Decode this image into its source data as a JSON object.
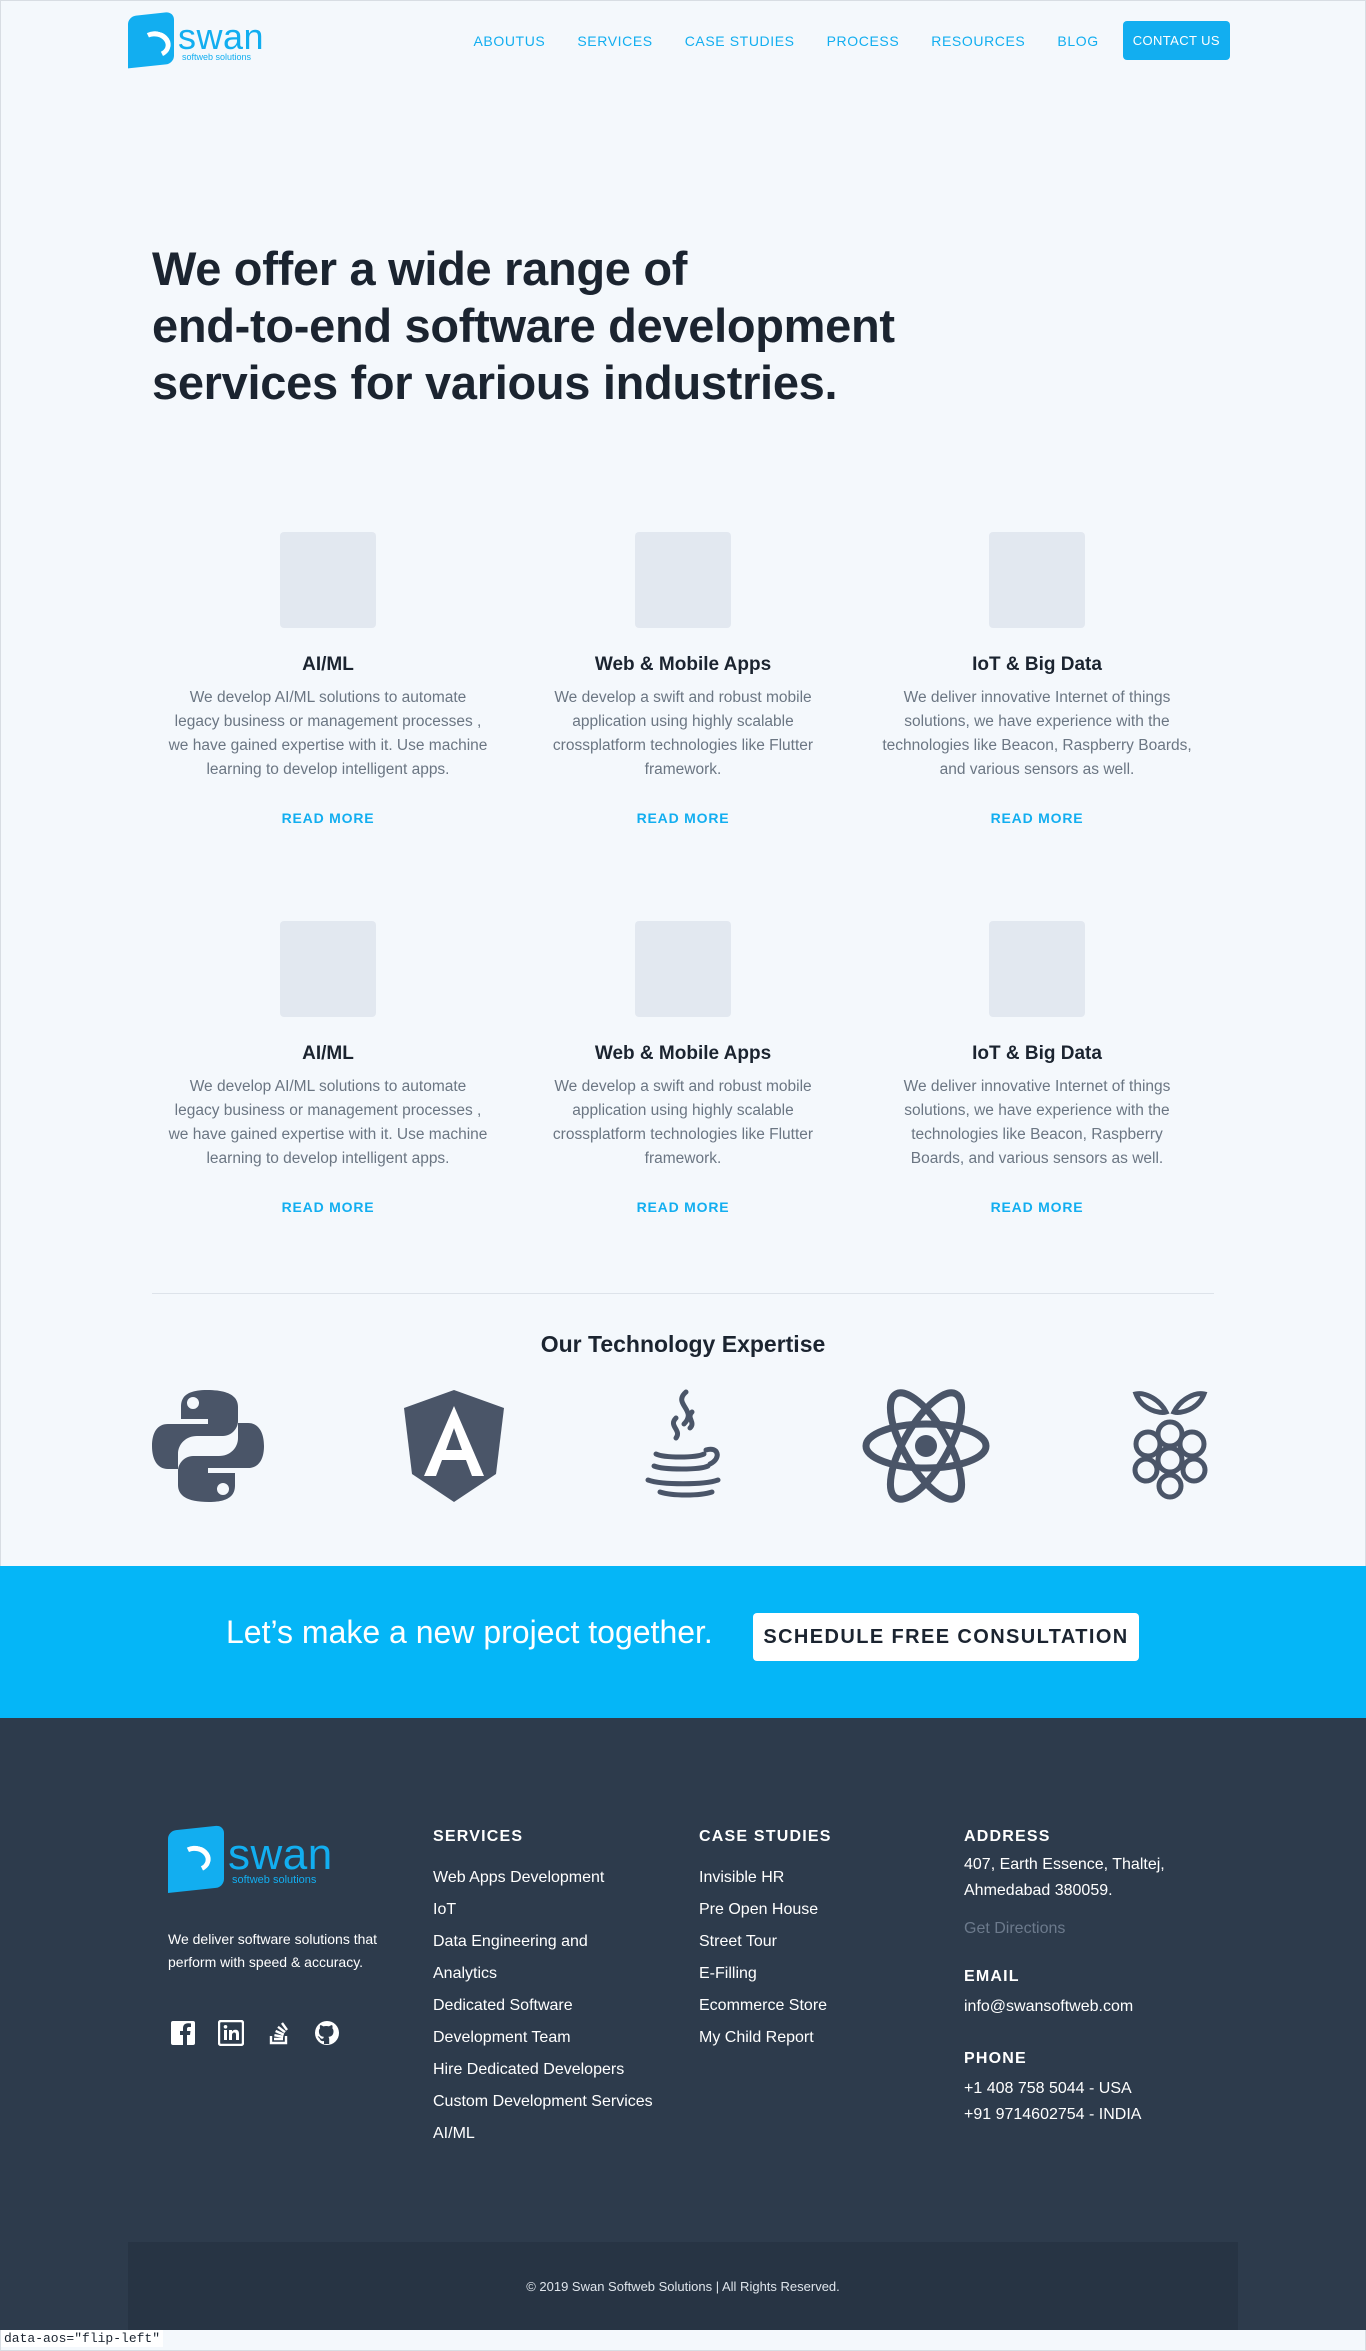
{
  "brand": {
    "name": "swan",
    "tagline": "softweb solutions"
  },
  "nav": {
    "items": [
      "ABOUTUS",
      "SERVICES",
      "CASE STUDIES",
      "PROCESS",
      "RESOURCES",
      "BLOG"
    ],
    "contact_label": "CONTACT US"
  },
  "hero": {
    "line1": "We offer a wide range of",
    "line2": "end-to-end software development",
    "line3": "services for various industries."
  },
  "services": [
    {
      "title": "AI/ML",
      "desc": "We develop AI/ML solutions to automate legacy business or management processes , we have gained expertise with it. Use machine learning to develop intelligent apps.",
      "link": "READ MORE"
    },
    {
      "title": "Web & Mobile Apps",
      "desc": "We develop a swift and robust mobile application using highly scalable crossplatform technologies like Flutter framework.",
      "link": "READ MORE"
    },
    {
      "title": "IoT & Big Data",
      "desc": "We deliver innovative Internet of things solutions, we have experience with the technologies like Beacon, Raspberry Boards, and various sensors as well.",
      "link": "READ MORE"
    },
    {
      "title": "AI/ML",
      "desc": "We develop AI/ML solutions to automate legacy business or management processes , we have gained expertise with it. Use machine learning to develop intelligent apps.",
      "link": "READ MORE"
    },
    {
      "title": "Web & Mobile Apps",
      "desc": "We develop a swift and robust mobile application using highly scalable crossplatform technologies like Flutter framework.",
      "link": "READ MORE"
    },
    {
      "title": "IoT & Big Data",
      "desc": "We deliver innovative Internet of things solutions, we have experience with the technologies like Beacon, Raspberry Boards, and various sensors as well.",
      "link": "READ MORE"
    }
  ],
  "tech": {
    "title": "Our Technology Expertise",
    "icons": [
      "python-icon",
      "angular-icon",
      "java-icon",
      "react-icon",
      "raspberry-pi-icon"
    ],
    "icon_color": "#4a5568"
  },
  "cta": {
    "text": "Let’s make a new project together.",
    "button": "SCHEDULE FREE CONSULTATION",
    "bg_color": "#05b6f7"
  },
  "footer": {
    "tagline": "We deliver software solutions that perform with speed & accuracy.",
    "social": [
      "facebook-icon",
      "linkedin-icon",
      "stackoverflow-icon",
      "github-icon"
    ],
    "services_heading": "SERVICES",
    "services": [
      "Web Apps Development",
      "IoT",
      "Data Engineering and",
      "Analytics",
      "Dedicated Software",
      "Development Team",
      "Hire Dedicated Developers",
      "Custom Development Services",
      "AI/ML"
    ],
    "cases_heading": "CASE STUDIES",
    "cases": [
      "Invisible HR",
      "Pre Open House",
      "Street Tour",
      "E-Filling",
      "Ecommerce Store",
      "My Child Report"
    ],
    "address_heading": "ADDRESS",
    "address_line1": "407, Earth Essence, Thaltej,",
    "address_line2": "Ahmedabad 380059.",
    "directions": "Get Directions",
    "email_heading": "EMAIL",
    "email": "info@swansoftweb.com",
    "phone_heading": "PHONE",
    "phone1": "+1 408 758 5044 - USA",
    "phone2": "+91 9714602754 - INDIA",
    "copyright": "© 2019 Swan Softweb Solutions | All Rights Reserved.",
    "bg_color": "#2d3b4c"
  },
  "status_note": "data-aos=\"flip-left\""
}
